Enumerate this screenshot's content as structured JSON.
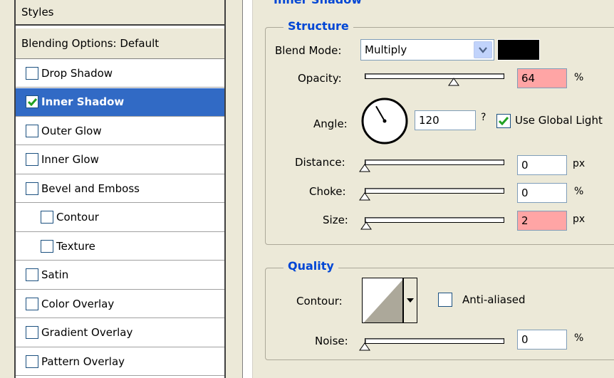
{
  "styles_list": {
    "header": "Styles",
    "blending_options": "Blending Options: Default",
    "items": [
      {
        "label": "Drop Shadow",
        "checked": false,
        "selected": false,
        "indent": false
      },
      {
        "label": "Inner Shadow",
        "checked": true,
        "selected": true,
        "indent": false
      },
      {
        "label": "Outer Glow",
        "checked": false,
        "selected": false,
        "indent": false
      },
      {
        "label": "Inner Glow",
        "checked": false,
        "selected": false,
        "indent": false
      },
      {
        "label": "Bevel and Emboss",
        "checked": false,
        "selected": false,
        "indent": false
      },
      {
        "label": "Contour",
        "checked": false,
        "selected": false,
        "indent": true
      },
      {
        "label": "Texture",
        "checked": false,
        "selected": false,
        "indent": true
      },
      {
        "label": "Satin",
        "checked": false,
        "selected": false,
        "indent": false
      },
      {
        "label": "Color Overlay",
        "checked": false,
        "selected": false,
        "indent": false
      },
      {
        "label": "Gradient Overlay",
        "checked": false,
        "selected": false,
        "indent": false
      },
      {
        "label": "Pattern Overlay",
        "checked": false,
        "selected": false,
        "indent": false
      }
    ]
  },
  "panel": {
    "title_cut": "Inner Shadow"
  },
  "structure": {
    "title": "Structure",
    "blend_mode_label": "Blend Mode:",
    "blend_mode_value": "Multiply",
    "blend_color": "#000000",
    "opacity_label": "Opacity:",
    "opacity_value": "64",
    "opacity_unit": "%",
    "opacity_fraction": 0.64,
    "angle_label": "Angle:",
    "angle_value": "120",
    "angle_unit": "?",
    "use_global_light_label": "Use Global Light",
    "use_global_light_checked": true,
    "distance_label": "Distance:",
    "distance_value": "0",
    "distance_unit": "px",
    "choke_label": "Choke:",
    "choke_value": "0",
    "choke_unit": "%",
    "size_label": "Size:",
    "size_value": "2",
    "size_unit": "px"
  },
  "quality": {
    "title": "Quality",
    "contour_label": "Contour:",
    "anti_aliased_label": "Anti-aliased",
    "anti_aliased_checked": false,
    "noise_label": "Noise:",
    "noise_value": "0",
    "noise_unit": "%"
  },
  "colors": {
    "selection": "#316ac5",
    "highlight_field": "#ffa5a5",
    "group_title": "#0046d5"
  }
}
